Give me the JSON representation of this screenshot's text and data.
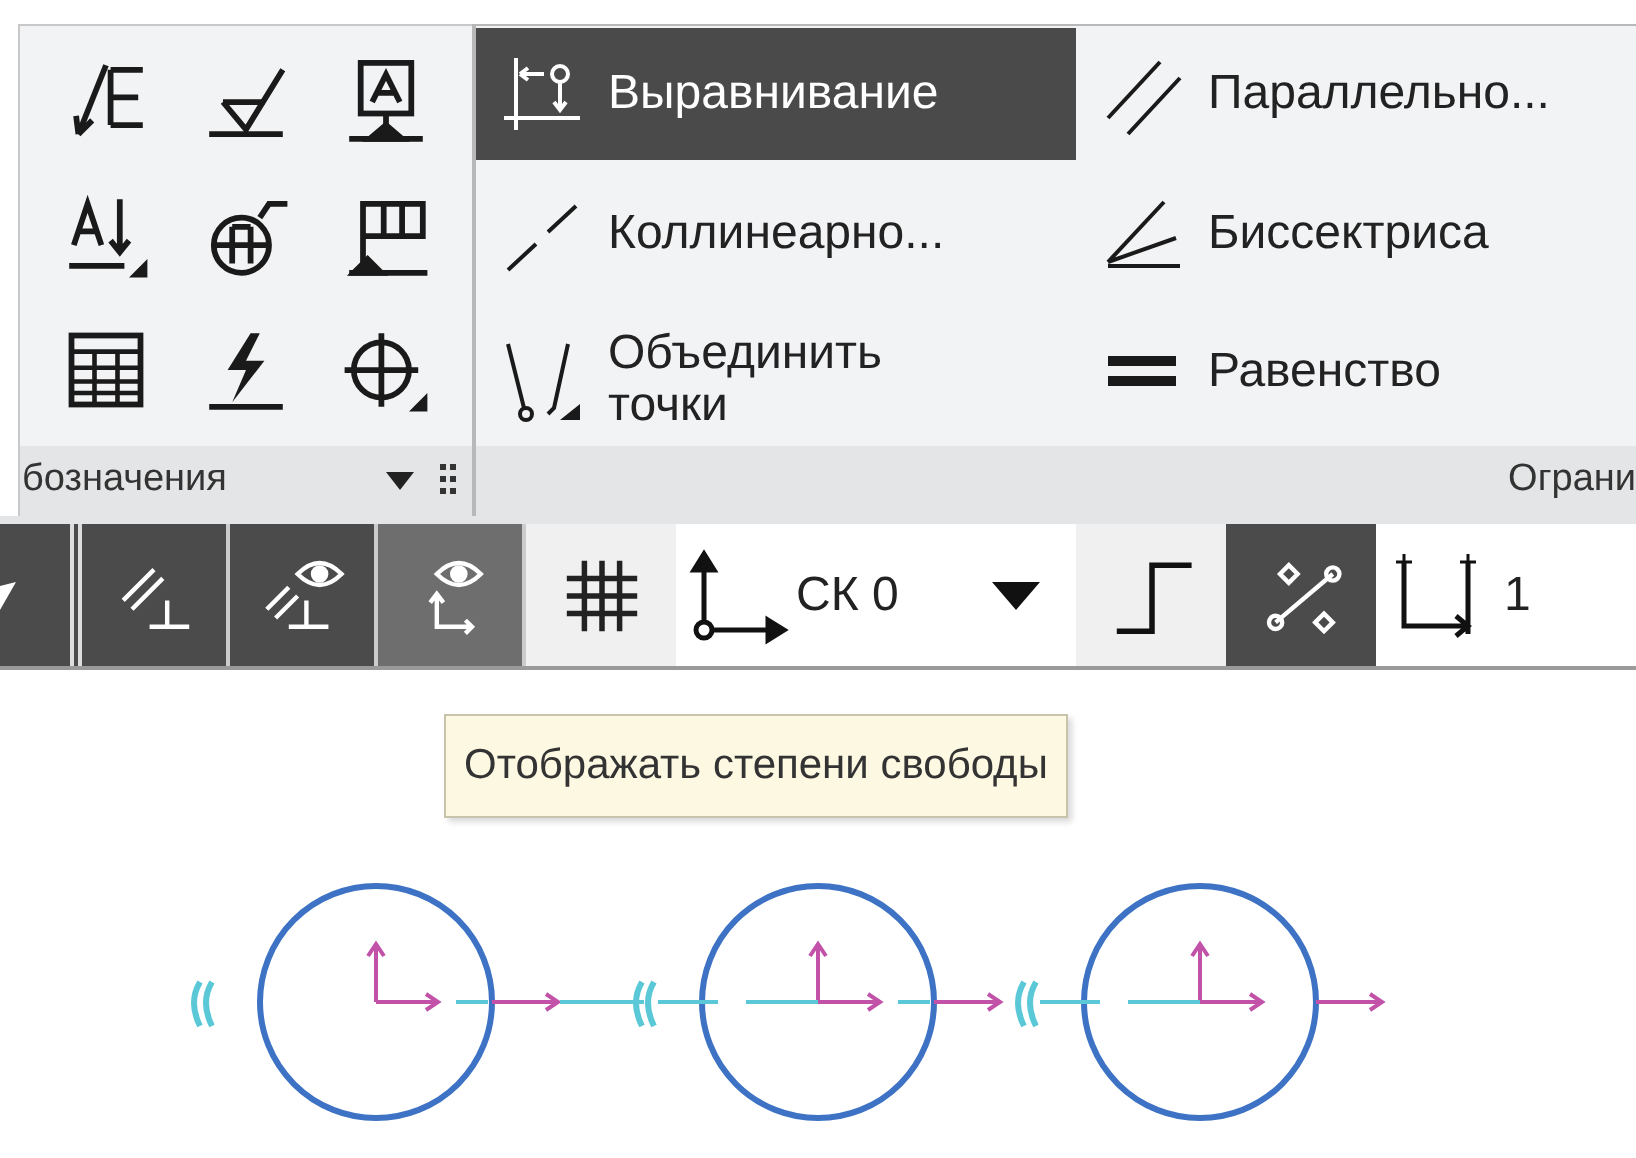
{
  "ribbon": {
    "left_group": {
      "label": "бозначения"
    },
    "right_group": {
      "label": "Ограни",
      "commands": [
        {
          "label": "Выравнивание",
          "selected": true
        },
        {
          "label": "Коллинеарно...",
          "selected": false
        },
        {
          "label": "Объединить\nточки",
          "selected": false
        },
        {
          "label": "Параллельно...",
          "selected": false
        },
        {
          "label": "Биссектриса",
          "selected": false
        },
        {
          "label": "Равенство",
          "selected": false
        }
      ]
    }
  },
  "toolbar": {
    "toggles": [
      {
        "selected": false
      },
      {
        "selected": false
      },
      {
        "selected": true
      }
    ],
    "coordinate_system": {
      "value": "СК 0"
    },
    "layer": {
      "value": "1"
    }
  },
  "tooltip": {
    "text": "Отображать степени свободы"
  }
}
